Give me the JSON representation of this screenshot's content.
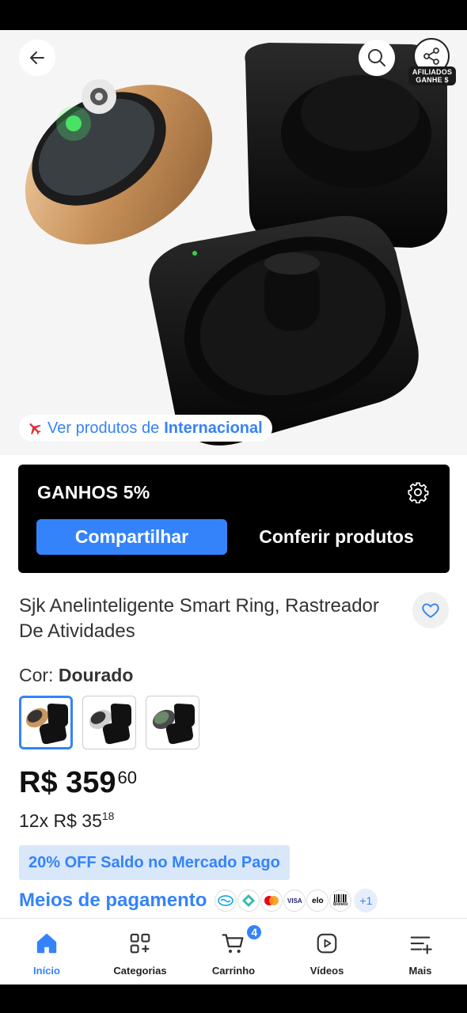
{
  "hero": {
    "affiliate_tag_line1": "AFILIADOS",
    "affiliate_tag_line2": "GANHE $",
    "intl_prefix": "Ver produtos de",
    "intl_store": "Internacional"
  },
  "affiliate": {
    "title": "GANHOS 5%",
    "share_label": "Compartilhar",
    "products_label": "Conferir produtos"
  },
  "product": {
    "title": "Sjk Anelinteligente Smart Ring, Rastreador De Atividades",
    "color_label": "Cor:",
    "color_value": "Dourado",
    "swatches": [
      {
        "name": "Dourado",
        "ring_color": "#c9975f"
      },
      {
        "name": "Prata",
        "ring_color": "#cfcfcf"
      },
      {
        "name": "Preto",
        "ring_color": "#3a3a3a"
      }
    ],
    "price_main": "R$ 359",
    "price_cents": "60",
    "installments_prefix": "12x",
    "installments_main": "R$ 35",
    "installments_cents": "18",
    "discount": "20% OFF Saldo no Mercado Pago",
    "payment_link": "Meios de pagamento",
    "payment_more": "+1",
    "payment_methods": [
      "mercado-pago-icon",
      "pix-icon",
      "mastercard-icon",
      "visa-icon",
      "elo-icon",
      "boleto-icon"
    ],
    "visa_text": "VISA",
    "elo_text": "elo",
    "boleto_text": "Boleto"
  },
  "nav": {
    "items": [
      {
        "label": "Início",
        "icon": "home-icon",
        "active": true
      },
      {
        "label": "Categorias",
        "icon": "categories-icon"
      },
      {
        "label": "Carrinho",
        "icon": "cart-icon",
        "badge": "4"
      },
      {
        "label": "Vídeos",
        "icon": "video-icon"
      },
      {
        "label": "Mais",
        "icon": "menu-plus-icon"
      }
    ]
  },
  "colors": {
    "accent": "#3483fa",
    "affiliate_bg": "#000000",
    "discount_bg": "#d9e7fa"
  }
}
